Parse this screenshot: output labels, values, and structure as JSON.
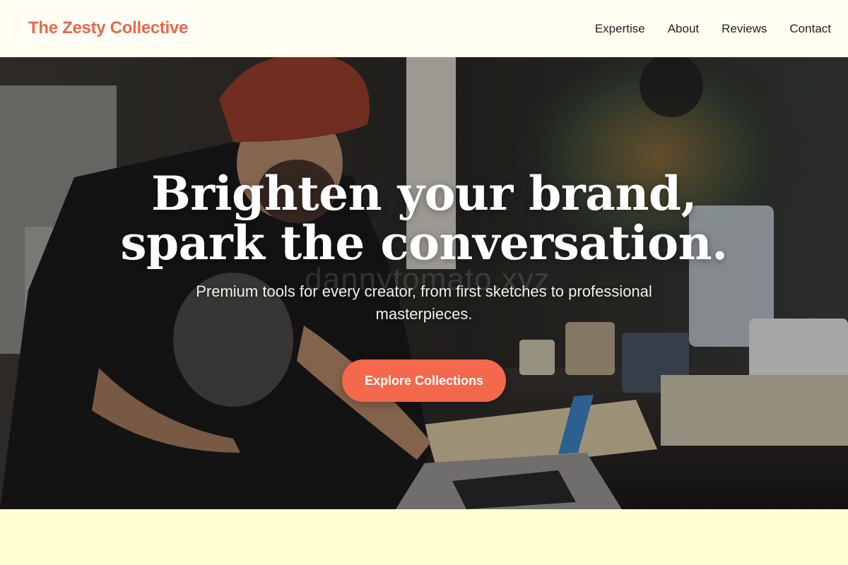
{
  "brand": {
    "name": "The Zesty Collective"
  },
  "nav": {
    "items": [
      {
        "label": "Expertise"
      },
      {
        "label": "About"
      },
      {
        "label": "Reviews"
      },
      {
        "label": "Contact"
      }
    ]
  },
  "hero": {
    "title_line1": "Brighten your brand,",
    "title_line2": "spark the conversation.",
    "subtitle": "Premium tools for every creator, from first sketches to professional masterpieces.",
    "cta_label": "Explore Collections",
    "watermark": "dannytomato.xyz",
    "photo_subject": "artist drawing at a cluttered studio desk with laptop and paint jars"
  },
  "colors": {
    "brand": "#e8684a",
    "cta": "#f4684c",
    "nav_background": "#fffef0",
    "section_background": "#ffffd3"
  }
}
